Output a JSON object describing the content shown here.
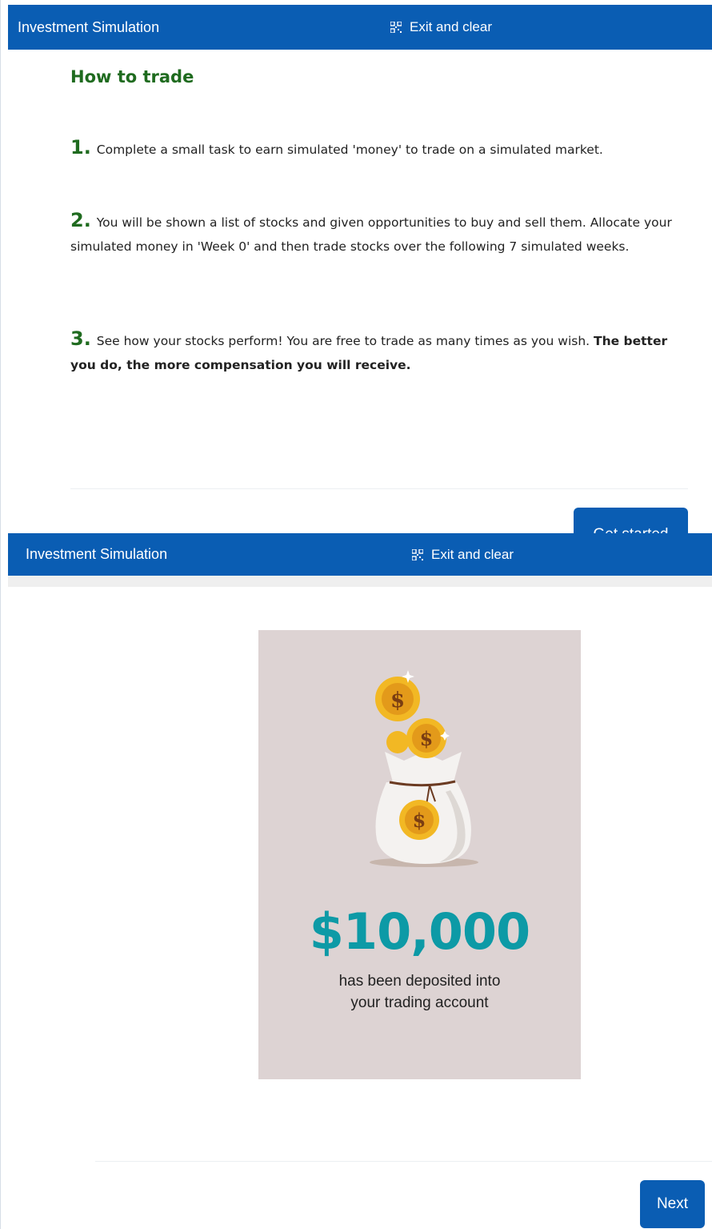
{
  "screen1": {
    "header": {
      "title": "Investment Simulation",
      "exit_label": "Exit and clear",
      "exit_icon": "qr-code-icon"
    },
    "section_title": "How to trade",
    "steps": [
      {
        "number": "1.",
        "text": "Complete a small task to earn simulated 'money' to trade on a simulated market."
      },
      {
        "number": "2.",
        "text": "You will be shown a list of stocks and given opportunities to buy and sell them. Allocate your simulated money in 'Week 0' and then trade stocks over the following 7 simulated weeks."
      },
      {
        "number": "3.",
        "text": "See how your stocks perform! You are free to trade as many times as you wish. ",
        "bold_text": "The better you do, the more compensation you will receive."
      }
    ],
    "get_started_label": "Get started"
  },
  "screen2": {
    "header": {
      "title": "Investment Simulation",
      "exit_label": "Exit and clear",
      "exit_icon": "qr-code-icon"
    },
    "card": {
      "amount": "$10,000",
      "line1": "has been deposited into",
      "line2": "your trading account",
      "illustration": "money-bag-icon",
      "coin_symbol": "$"
    },
    "next_label": "Next"
  },
  "colors": {
    "header_bg": "#0a5db3",
    "title_green": "#1f6b1f",
    "amount_teal": "#0d9aa6",
    "card_bg": "#ddd3d3",
    "coin_gold": "#f2b824"
  }
}
